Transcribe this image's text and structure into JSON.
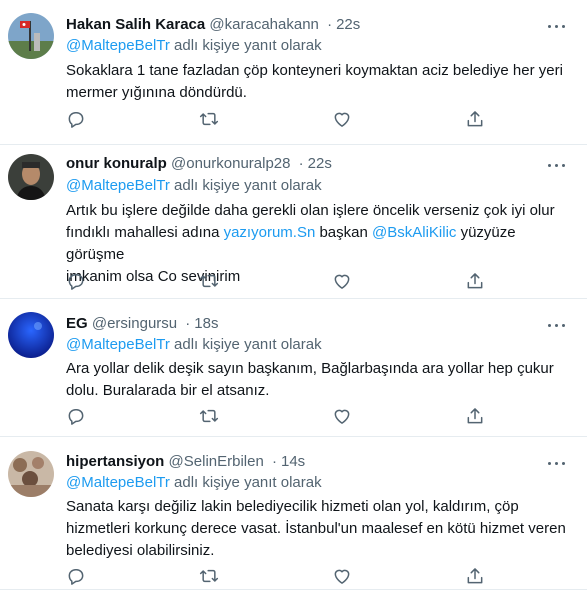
{
  "tweets": [
    {
      "name": "Hakan Salih Karaca",
      "handle": "@karacahakann",
      "separator": "·",
      "time": "22s",
      "reply_mention": "@MaltepeBelTr",
      "reply_suffix": " adlı kişiye yanıt olarak",
      "text_line1": "Sokaklara 1 tane fazladan çöp konteyneri koymaktan aciz belediye her yeri",
      "text_line2": "mermer yığınına döndürdü."
    },
    {
      "name": "onur konuralp",
      "handle": "@onurkonuralp28",
      "separator": "·",
      "time": "22s",
      "reply_mention": "@MaltepeBelTr",
      "reply_suffix": " adlı kişiye yanıt olarak",
      "text_line1": "Artık bu işlere değilde daha gerekli olan işlere öncelik verseniz çok iyi olur",
      "text_line2_a": "fındıklı mahallesi adına ",
      "text_line2_link1": "yazıyorum.Sn",
      "text_line2_b": " başkan ",
      "text_line2_link2": "@BskAliKilic",
      "text_line2_c": " yüzyüze görüşme",
      "text_line3": "imkanim olsa Co sevinirim"
    },
    {
      "name": "EG",
      "handle": "@ersingursu",
      "separator": "·",
      "time": "18s",
      "reply_mention": "@MaltepeBelTr",
      "reply_suffix": " adlı kişiye yanıt olarak",
      "text_line1": "Ara yollar delik deşik sayın başkanım, Bağlarbaşında ara yollar hep çukur",
      "text_line2": "dolu. Buralarada bir el atsanız."
    },
    {
      "name": "hipertansiyon",
      "handle": "@SelinErbilen",
      "separator": "·",
      "time": "14s",
      "reply_mention": "@MaltepeBelTr",
      "reply_suffix": " adlı kişiye yanıt olarak",
      "text_line1": "Sanata karşı değiliz lakin belediyecilik hizmeti olan yol, kaldırım, çöp",
      "text_line2": "hizmetleri korkunç derece vasat. İstanbul'un maalesef en kötü hizmet veren",
      "text_line3": "belediyesi olabilirsiniz."
    }
  ],
  "icons": {
    "reply": "reply-icon",
    "retweet": "retweet-icon",
    "like": "heart-icon",
    "share": "share-icon",
    "more": "more-icon"
  },
  "colors": {
    "accent": "#1d9bf0",
    "secondary": "#536471",
    "text": "#0f1419",
    "divider": "#e6ecf0"
  }
}
